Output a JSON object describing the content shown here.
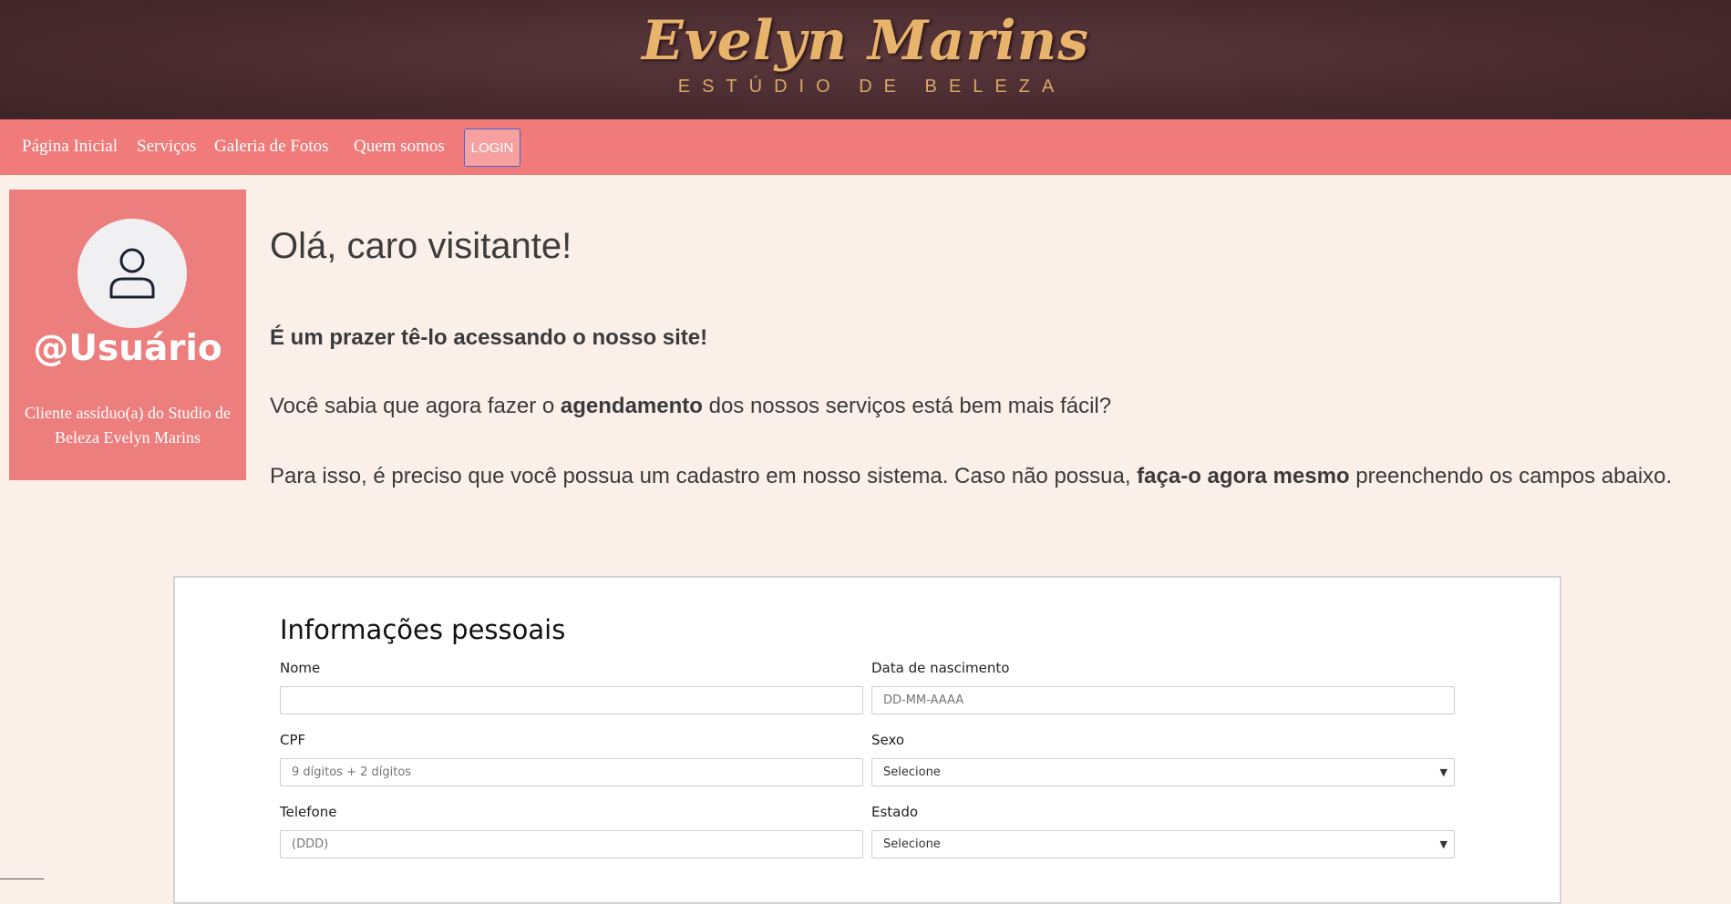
{
  "header": {
    "brand_name": "Evelyn Marins",
    "brand_tagline": "ESTÚDIO DE BELEZA"
  },
  "nav": {
    "items": [
      "Página Inicial",
      "Serviços",
      "Galeria de Fotos",
      "Quem somos"
    ],
    "login_label": "LOGIN"
  },
  "profile": {
    "avatar_icon": "user-icon",
    "username": "@Usuário",
    "description": "Cliente assíduo(a) do Studio de Beleza Evelyn Marins"
  },
  "main": {
    "title": "Olá, caro visitante!",
    "intro": "É um prazer tê-lo acessando o nosso site!",
    "para1_before": "Você sabia que agora fazer o ",
    "para1_bold": "agendamento",
    "para1_after": " dos nossos serviços está bem mais fácil?",
    "para2_before": "Para isso, é preciso que você possua um cadastro em nosso sistema. Caso não possua, ",
    "para2_bold": "faça-o agora mesmo",
    "para2_after": " preenchendo os campos abaixo."
  },
  "form": {
    "title": "Informações pessoais",
    "nome": {
      "label": "Nome",
      "value": ""
    },
    "nascimento": {
      "label": "Data de nascimento",
      "placeholder": "DD-MM-AAAA"
    },
    "cpf": {
      "label": "CPF",
      "placeholder": "9 dígitos + 2 dígitos"
    },
    "sexo": {
      "label": "Sexo",
      "selected": "Selecione"
    },
    "telefone": {
      "label": "Telefone",
      "placeholder": "(DDD)"
    },
    "estado": {
      "label": "Estado",
      "selected": "Selecione"
    }
  },
  "colors": {
    "header_bg": "#4a2c30",
    "nav_bg": "#f07b7a",
    "card_bg": "#ec7f7d",
    "page_bg": "#fbefea",
    "brand_gold": "#e8b36a"
  }
}
